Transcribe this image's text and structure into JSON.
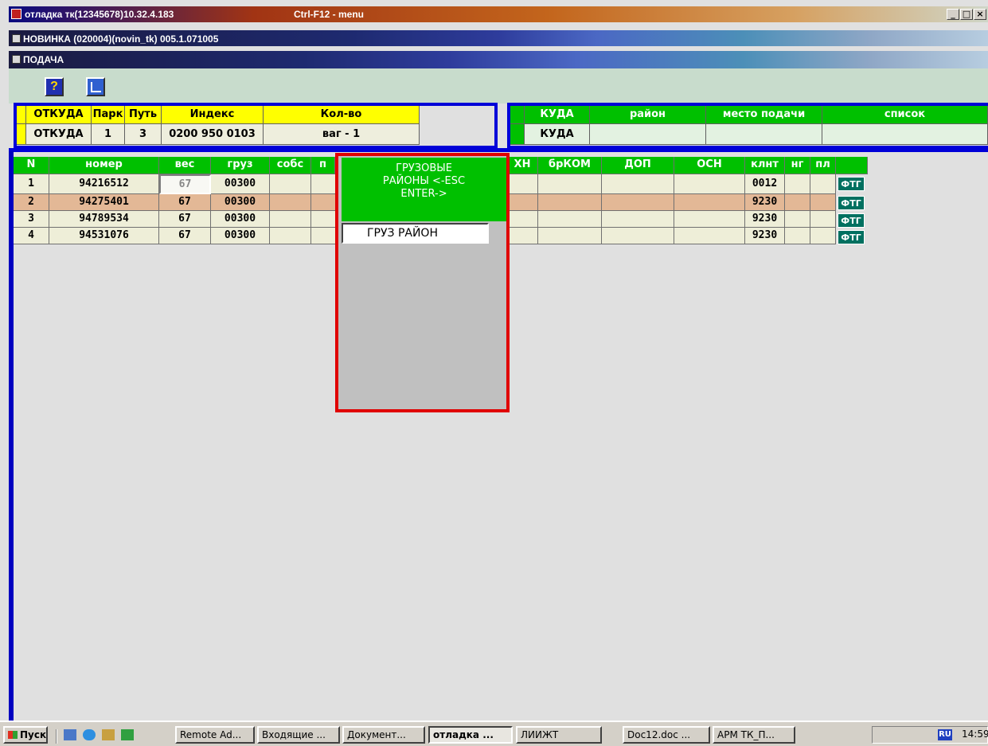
{
  "window": {
    "title": "отладка тк(12345678)10.32.4.183",
    "menu_hint": "Ctrl-F12 - menu",
    "min": "_",
    "max": "□",
    "close": "×"
  },
  "subwindow": {
    "title": "НОВИНКА (020004)(novin_tk) 005.1.071005"
  },
  "form": {
    "title": "ПОДАЧА"
  },
  "toolbar": {
    "help": "?"
  },
  "from_panel": {
    "headers": [
      "ОТКУДА",
      "Парк",
      "Путь",
      "Индекс",
      "Кол-во"
    ],
    "values": [
      "ОТКУДА",
      "1",
      "3",
      "0200 950 0103",
      "ваг - 1"
    ]
  },
  "to_panel": {
    "headers": [
      "КУДА",
      "район",
      "место подачи",
      "список"
    ],
    "values": [
      "КУДА",
      "",
      "",
      ""
    ]
  },
  "grid": {
    "headers": [
      "N",
      "номер",
      "вес",
      "груз",
      "собс",
      "п",
      "ХН",
      "брКОМ",
      "ДОП",
      "ОСН",
      "клнт",
      "нг",
      "пл"
    ],
    "rows": [
      {
        "n": "1",
        "number": "94216512",
        "weight": "67",
        "cargo": "00300",
        "client": "0012",
        "action": "ФТГ"
      },
      {
        "n": "2",
        "number": "94275401",
        "weight": "67",
        "cargo": "00300",
        "client": "9230",
        "action": "ФТГ"
      },
      {
        "n": "3",
        "number": "94789534",
        "weight": "67",
        "cargo": "00300",
        "client": "9230",
        "action": "ФТГ"
      },
      {
        "n": "4",
        "number": "94531076",
        "weight": "67",
        "cargo": "00300",
        "client": "9230",
        "action": "ФТГ"
      }
    ]
  },
  "popup": {
    "line1": "ГРУЗОВЫЕ",
    "line2": "РАЙОНЫ <-ESC",
    "line3": "ENTER->",
    "input_value": "ГРУЗ РАЙОН"
  },
  "taskbar": {
    "start": "Пуск",
    "tasks": [
      "Remote Ad...",
      "Входящие ...",
      "Документ...",
      "отладка ...",
      "ЛИИЖТ",
      "Doc12.doc ...",
      "АРМ ТК_П..."
    ],
    "clock": "14:59",
    "lang": "RU"
  },
  "colors": {
    "header_green": "#00c000",
    "header_yellow": "#ffff00",
    "panel_border": "#0000d8",
    "popup_border": "#e00000"
  }
}
